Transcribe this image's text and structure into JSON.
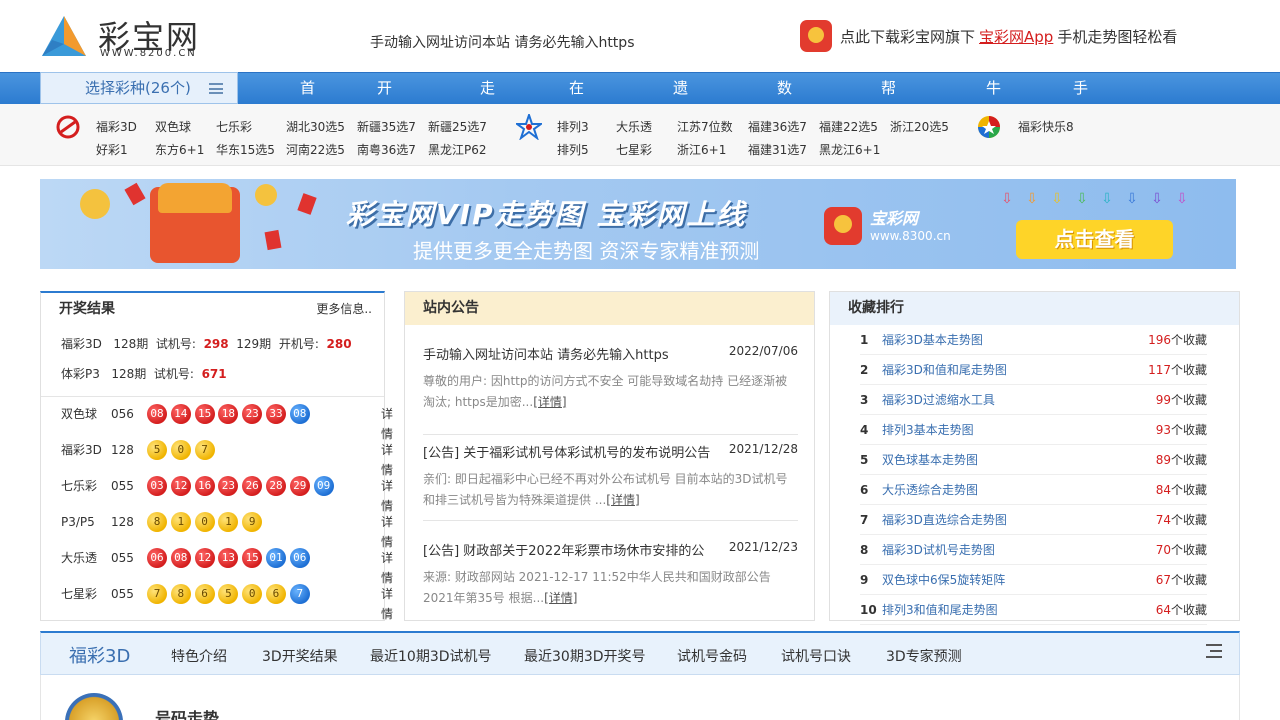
{
  "header": {
    "logo_name": "彩宝网",
    "logo_url": "WWW.8200.CN",
    "notice": "手动输入网址访问本站 请务必先输入https",
    "app_promo": {
      "prefix": "点此下载彩宝网旗下",
      "link": "宝彩网App",
      "suffix": "手机走势图轻松看"
    }
  },
  "nav": {
    "select_label": "选择彩种(26个)",
    "items": [
      "首 页",
      "开奖公告",
      "走势图",
      "在线工具",
      "遗漏查询",
      "数据图表",
      "帮助中心",
      "牛票票",
      "手机彩宝网"
    ]
  },
  "lottery_bar": {
    "welfare": [
      "福彩3D",
      "双色球",
      "七乐彩",
      "湖北30选5",
      "新疆35选7",
      "新疆25选7",
      "好彩1",
      "东方6+1",
      "华东15选5",
      "河南22选5",
      "南粤36选7",
      "黑龙江P62"
    ],
    "sports": [
      "排列3",
      "大乐透",
      "江苏7位数",
      "福建36选7",
      "福建22选5",
      "浙江20选5",
      "排列5",
      "七星彩",
      "浙江6+1",
      "福建31选7",
      "黑龙江6+1"
    ],
    "other": [
      "福彩快乐8"
    ]
  },
  "banner": {
    "title": "彩宝网VIP走势图  宝彩网上线",
    "subtitle": "提供更多更全走势图  资深专家精准预测",
    "app_name": "宝彩网",
    "app_url": "www.8300.cn",
    "button": "点击查看"
  },
  "results": {
    "title": "开奖结果",
    "more": "更多信息..",
    "test_lines": [
      {
        "name": "福彩3D",
        "issue": "128期",
        "label": "试机号:",
        "num": "298",
        "issue2": "129期",
        "label2": "开机号:",
        "num2": "280"
      },
      {
        "name": "体彩P3",
        "issue": "128期",
        "label": "试机号:",
        "num": "671"
      }
    ],
    "detail_label": "详情",
    "rows": [
      {
        "name": "双色球",
        "issue": "056",
        "balls": [
          {
            "n": "08",
            "c": "red"
          },
          {
            "n": "14",
            "c": "red"
          },
          {
            "n": "15",
            "c": "red"
          },
          {
            "n": "18",
            "c": "red"
          },
          {
            "n": "23",
            "c": "red"
          },
          {
            "n": "33",
            "c": "red"
          },
          {
            "n": "08",
            "c": "blue"
          }
        ]
      },
      {
        "name": "福彩3D",
        "issue": "128",
        "balls": [
          {
            "n": "5",
            "c": "yel"
          },
          {
            "n": "0",
            "c": "yel"
          },
          {
            "n": "7",
            "c": "yel"
          }
        ]
      },
      {
        "name": "七乐彩",
        "issue": "055",
        "balls": [
          {
            "n": "03",
            "c": "red"
          },
          {
            "n": "12",
            "c": "red"
          },
          {
            "n": "16",
            "c": "red"
          },
          {
            "n": "23",
            "c": "red"
          },
          {
            "n": "26",
            "c": "red"
          },
          {
            "n": "28",
            "c": "red"
          },
          {
            "n": "29",
            "c": "red"
          },
          {
            "n": "09",
            "c": "blue"
          }
        ]
      },
      {
        "name": "P3/P5",
        "issue": "128",
        "balls": [
          {
            "n": "8",
            "c": "yel"
          },
          {
            "n": "1",
            "c": "yel"
          },
          {
            "n": "0",
            "c": "yel"
          },
          {
            "n": "1",
            "c": "yel"
          },
          {
            "n": "9",
            "c": "yel"
          }
        ]
      },
      {
        "name": "大乐透",
        "issue": "055",
        "balls": [
          {
            "n": "06",
            "c": "red"
          },
          {
            "n": "08",
            "c": "red"
          },
          {
            "n": "12",
            "c": "red"
          },
          {
            "n": "13",
            "c": "red"
          },
          {
            "n": "15",
            "c": "red"
          },
          {
            "n": "01",
            "c": "blue"
          },
          {
            "n": "06",
            "c": "blue"
          }
        ]
      },
      {
        "name": "七星彩",
        "issue": "055",
        "balls": [
          {
            "n": "7",
            "c": "yel"
          },
          {
            "n": "8",
            "c": "yel"
          },
          {
            "n": "6",
            "c": "yel"
          },
          {
            "n": "5",
            "c": "yel"
          },
          {
            "n": "0",
            "c": "yel"
          },
          {
            "n": "6",
            "c": "yel"
          },
          {
            "n": "7",
            "c": "blue"
          }
        ]
      }
    ]
  },
  "announcements": {
    "title": "站内公告",
    "detail_link": "[详情]",
    "items": [
      {
        "title": "手动输入网址访问本站 请务必先输入https",
        "date": "2022/07/06",
        "body": "尊敬的用户: 因http的访问方式不安全 可能导致域名劫持 已经逐渐被淘汰; https是加密..."
      },
      {
        "title": "[公告] 关于福彩试机号体彩试机号的发布说明公告",
        "date": "2021/12/28",
        "body": "亲们:  即日起福彩中心已经不再对外公布试机号 目前本站的3D试机号和排三试机号皆为特殊渠道提供 ..."
      },
      {
        "title": "[公告] 财政部关于2022年彩票市场休市安排的公",
        "date": "2021/12/23",
        "body": "来源:  财政部网站 2021-12-17 11:52中华人民共和国财政部公告2021年第35号 根据..."
      }
    ]
  },
  "favorites": {
    "title": "收藏排行",
    "unit": "个收藏",
    "items": [
      {
        "rank": "1",
        "name": "福彩3D基本走势图",
        "count": "196"
      },
      {
        "rank": "2",
        "name": "福彩3D和值和尾走势图",
        "count": "117"
      },
      {
        "rank": "3",
        "name": "福彩3D过滤缩水工具",
        "count": "99"
      },
      {
        "rank": "4",
        "name": "排列3基本走势图",
        "count": "93"
      },
      {
        "rank": "5",
        "name": "双色球基本走势图",
        "count": "89"
      },
      {
        "rank": "6",
        "name": "大乐透综合走势图",
        "count": "84"
      },
      {
        "rank": "7",
        "name": "福彩3D直选综合走势图",
        "count": "74"
      },
      {
        "rank": "8",
        "name": "福彩3D试机号走势图",
        "count": "70"
      },
      {
        "rank": "9",
        "name": "双色球中6保5旋转矩阵",
        "count": "67"
      },
      {
        "rank": "10",
        "name": "排列3和值和尾走势图",
        "count": "64"
      }
    ]
  },
  "subnav": {
    "title": "福彩3D",
    "links": [
      "特色介绍",
      "3D开奖结果",
      "最近10期3D试机号",
      "最近30期3D开奖号",
      "试机号金码",
      "试机号口诀",
      "3D专家预测"
    ]
  },
  "trend": {
    "title": "号码走势"
  },
  "colors": {
    "nav_blue": "#2c7bd0",
    "red": "#d41e1e",
    "link_blue": "#3a6fb0"
  }
}
